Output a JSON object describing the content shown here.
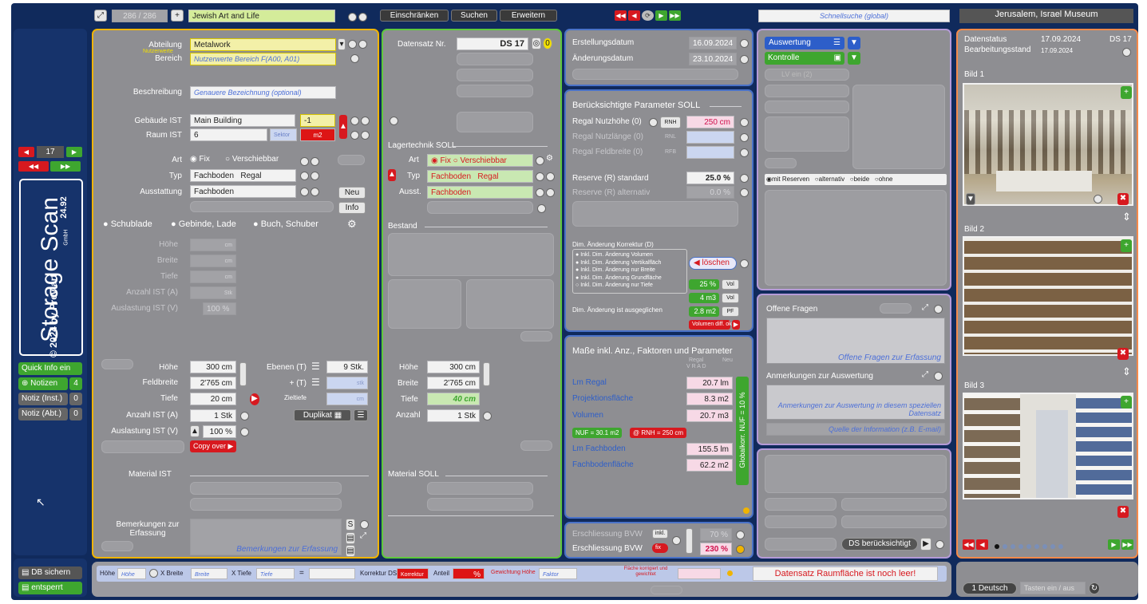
{
  "topbar": {
    "record_counter": "286 / 286",
    "plus": "+",
    "collection": "Jewish Art and Life",
    "buttons": [
      "Einschränken",
      "Suchen",
      "Erweitern"
    ],
    "quicksearch_placeholder": "Schnellsuche (global)",
    "institution": "Jerusalem, Israel Museum"
  },
  "sidebar": {
    "page": "17",
    "app_title": "Storage Scan",
    "version": "24.92",
    "copyright": "© 2024 by Prev art",
    "gmbh": "GmbH",
    "quick_info": "Quick Info ein",
    "notes": "Notizen",
    "notes_count": "4",
    "notiz_inst": "Notiz (Inst.)",
    "notiz_inst_count": "0",
    "notiz_abt": "Notiz (Abt.)",
    "notiz_abt_count": "0",
    "db_save": "DB sichern",
    "unlocked": "entsperrt"
  },
  "p1": {
    "abteilung_label": "Abteilung",
    "nutzerwerte": "Nutzerwerte",
    "bereich_label": "Bereich",
    "abteilung": "Metalwork",
    "bereich": "Nutzerwerte Bereich F(A00, A01)",
    "beschreibung_label": "Beschreibung",
    "beschreibung": "Genauere Bezeichnung (optional)",
    "gebaeude_label": "Gebäude IST",
    "gebaeude": "Main Building",
    "gebaeude_num": "-1",
    "raum_label": "Raum IST",
    "raum": "6",
    "sektor": "Sektor",
    "m2": "m2",
    "art_label": "Art",
    "fix": "Fix",
    "verschiebbar": "Verschiebbar",
    "typ_label": "Typ",
    "typ1": "Fachboden",
    "typ2": "Regal",
    "ausstattung_label": "Ausstattung",
    "ausstattung": "Fachboden",
    "neu": "Neu",
    "info": "Info",
    "schublade": "Schublade",
    "gebinde": "Gebinde, Lade",
    "buch": "Buch, Schuber",
    "hoehe_label": "Höhe",
    "breite_label": "Breite",
    "tiefe_label": "Tiefe",
    "anzahl_label": "Anzahl IST (A)",
    "auslastung_label": "Auslastung IST (V)",
    "cm": "cm",
    "stk": "Stk",
    "pct": "100 %",
    "hoehe2_label": "Höhe",
    "hoehe2": "300 cm",
    "feldbreite_label": "Feldbreite",
    "feldbreite": "2'765 cm",
    "tiefe2_label": "Tiefe",
    "tiefe2": "20 cm",
    "anzahl2_label": "Anzahl IST (A)",
    "anzahl2": "1 Stk",
    "auslastung2_label": "Auslastung IST (V)",
    "auslastung2": "100 %",
    "copy_over": "Copy over ▶",
    "ebenen_label": "Ebenen (T)",
    "ebenen": "9 Stk.",
    "plus_t": "+ (T)",
    "stk2": "stk",
    "zieltiefe": "Zieltiefe",
    "duplikat": "Duplikat",
    "material_label": "Material IST",
    "bemerk_label": "Bemerkungen zur Erfassung",
    "bemerk_placeholder": "Bemerkungen zur Erfassung"
  },
  "p2": {
    "datensatz_label": "Datensatz Nr.",
    "datensatz": "DS 17",
    "lagertechnik": "Lagertechnik SOLL",
    "art_label": "Art",
    "fix": "Fix",
    "verschiebbar": "Verschiebbar",
    "typ_label": "Typ",
    "typ1": "Fachboden",
    "typ2": "Regal",
    "ausst_label": "Ausst.",
    "ausst": "Fachboden",
    "bestand": "Bestand",
    "hoehe_label": "Höhe",
    "hoehe": "300 cm",
    "breite_label": "Breite",
    "breite": "2'765 cm",
    "tiefe_label": "Tiefe",
    "tiefe": "40 cm",
    "anzahl_label": "Anzahl",
    "anzahl": "1 Stk",
    "material_label": "Material SOLL"
  },
  "p3": {
    "erst_label": "Erstellungsdatum",
    "erst": "16.09.2024",
    "aend_label": "Änderungsdatum",
    "aend": "23.10.2024",
    "params_title": "Berücksichtigte Parameter SOLL",
    "nutzhoehe_label": "Regal Nutzhöhe (0)",
    "rnh": "RNH",
    "nutzhoehe": "250 cm",
    "nutzlaenge_label": "Regal Nutzlänge (0)",
    "rnl": "RNL",
    "feldbreite_label": "Regal Feldbreite (0)",
    "rfb": "RFB",
    "reserve_label": "Reserve (R) standard",
    "reserve": "25.0 %",
    "reserve_alt_label": "Reserve (R) alternativ",
    "reserve_alt": "0.0 %",
    "dim_title": "Dim. Änderung Korrektur (D)",
    "dim_opts": [
      "Inkl. Dim. Änderung Volumen",
      "Inkl. Dim. Änderung Vertikalfläch",
      "Inkl. Dim. Änderung nur Breite",
      "Inkl. Dim. Änderung Grundfläche",
      "Inkl. Dim. Änderung nur Tiefe"
    ],
    "loeschen": "◀ löschen",
    "v25": "25 %",
    "vol": "Vol",
    "v4": "4 m3",
    "vol2": "Vol",
    "dim_ausgeglichen": "Dim. Änderung ist ausgeglichen",
    "v28": "2.8 m2",
    "pf": "PF",
    "volumen_diff": "Volumen diff. ok",
    "masse_title": "Maße inkl. Anz., Faktoren und Parameter",
    "regal_h": "Regal",
    "neu_h": "Neu",
    "vrad": "V R A D",
    "lm_regal_label": "Lm Regal",
    "lm_regal": "20.7 lm",
    "proj_label": "Projektionsfläche",
    "proj": "8.3 m2",
    "vol_label": "Volumen",
    "volumen": "20.7 m3",
    "nuf": "NUF = 30.1 m2",
    "rnh_tag": "@ RNH = 250 cm",
    "lm_fach_label": "Lm Fachboden",
    "lm_fach": "155.5 lm",
    "fachfl_label": "Fachbodenfläche",
    "fachfl": "62.2 m2",
    "globalkorr": "Globalkorr. NUF = 10 %",
    "ersch1_label": "Erschliessung BVW",
    "inkl": "inkl.",
    "ersch1": "70 %",
    "ersch2_label": "Erschliessung BVW",
    "fix_tag": "fix",
    "ersch2": "230 %"
  },
  "p4": {
    "auswertung": "Auswertung",
    "kontrolle": "Kontrolle",
    "lv": "LV ein  (2)",
    "reserve_opts": [
      "mit Reserven",
      "alternativ",
      "beide",
      "ohne"
    ],
    "offene_title": "Offene Fragen",
    "offene_placeholder": "Offene Fragen zur Erfassung",
    "anm_title": "Anmerkungen zur Auswertung",
    "anm_placeholder": "Anmerkungen zur Auswertung in diesem speziellen Datensatz",
    "quelle": "Quelle der Information (z.B. E-mail)",
    "ds_beruecksichtigt": "DS berücksichtigt"
  },
  "p5": {
    "status_label": "Datenstatus",
    "status_date": "17.09.2024",
    "ds": "DS 17",
    "bearb_label": "Bearbeitungsstand",
    "bearb_date": "17.09.2024",
    "bild1": "Bild 1",
    "bild2": "Bild 2",
    "bild3": "Bild 3"
  },
  "bottom": {
    "hoehe": "Höhe",
    "hoehe_ph": "Höhe",
    "xbreite": "X Breite",
    "breite_ph": "Breite",
    "xtiefe": "X Tiefe",
    "tiefe_ph": "Tiefe",
    "eq": "=",
    "korrektur_ds": "Korrektur DS",
    "korrektur": "Korrektur",
    "anteil": "Anteil",
    "pct": "%",
    "gewichtung": "Gewichtung Höhe",
    "faktor": "Faktor",
    "flaeche": "Fläche korrigiert und gewichtet",
    "warning": "Datensatz Raumfläche ist noch leer!",
    "language": "1 Deutsch",
    "tasten": "Tasten ein / aus"
  },
  "colors": {
    "navy": "#102a5c",
    "panel": "#8e8e92",
    "yellow_border": "#f0b400",
    "green_border": "#5fc83c",
    "blue_border": "#4a72c8",
    "lilac_border": "#b49ad8",
    "orange_border": "#f58a4a",
    "red": "#d7191f",
    "green": "#3ea62f"
  }
}
